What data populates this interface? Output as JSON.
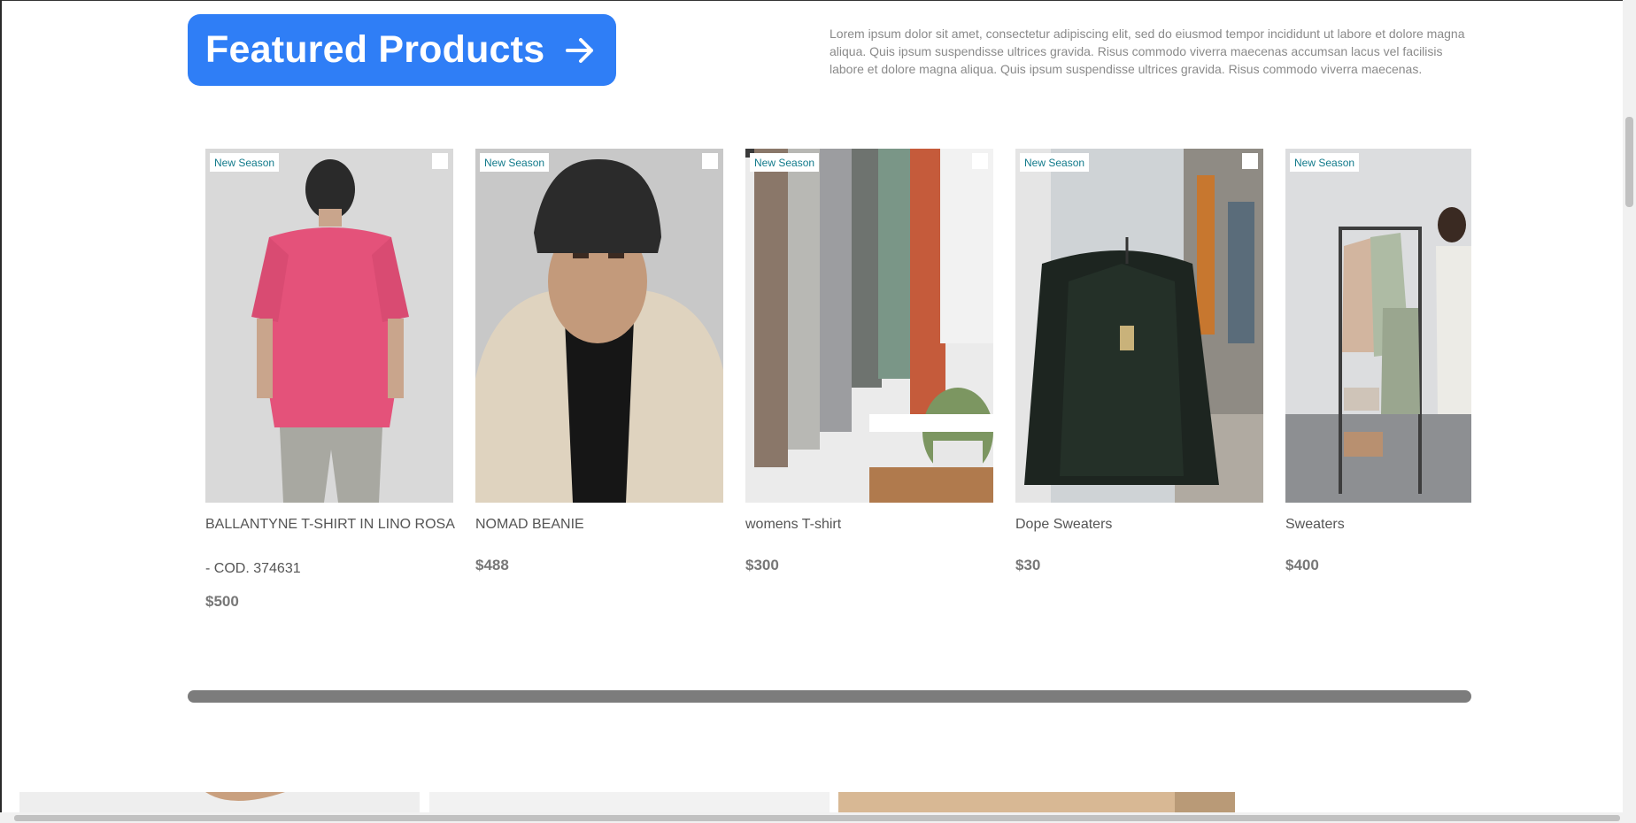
{
  "header": {
    "featured_label": "Featured Products",
    "intro_text": "Lorem ipsum dolor sit amet, consectetur adipiscing elit, sed do eiusmod tempor incididunt ut labore et dolore magna aliqua. Quis ipsum suspendisse ultrices gravida. Risus commodo viverra maecenas accumsan lacus vel facilisis labore et dolore magna aliqua. Quis ipsum suspendisse ultrices gravida. Risus commodo viverra maecenas."
  },
  "products": [
    {
      "badge": "New Season",
      "name": "BALLANTYNE T-SHIRT IN LINO ROSA - COD. 374631",
      "price": "$500"
    },
    {
      "badge": "New Season",
      "name": "NOMAD BEANIE",
      "price": "$488"
    },
    {
      "badge": "New Season",
      "name": "womens T-shirt",
      "price": "$300"
    },
    {
      "badge": "New Season",
      "name": "Dope Sweaters",
      "price": "$30"
    },
    {
      "badge": "New Season",
      "name": "Sweaters",
      "price": "$400"
    }
  ],
  "colors": {
    "accent": "#2f7ef6",
    "badge_text": "#117a8b",
    "scrollbar": "#7c7c7c"
  }
}
